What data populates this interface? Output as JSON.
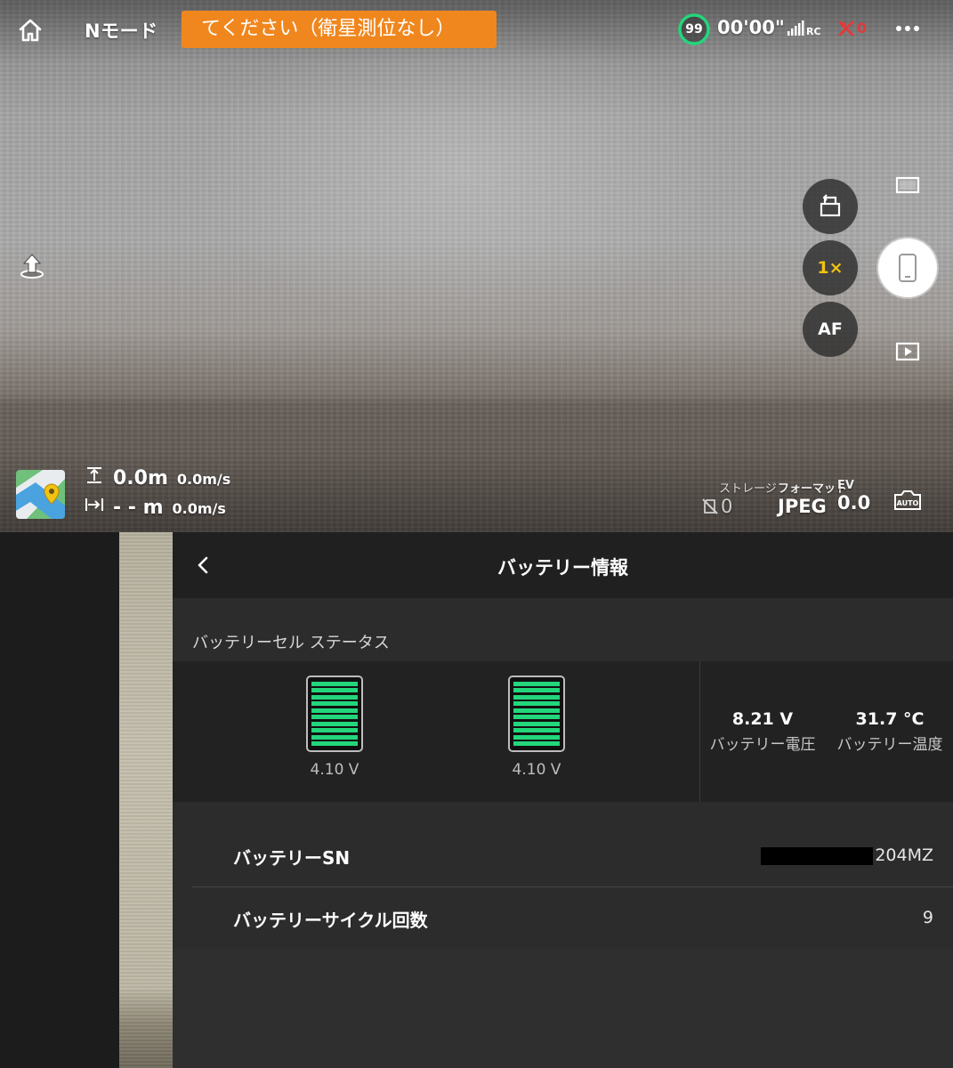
{
  "top_bar": {
    "mode": "Nモード",
    "warning": "てください（衛星測位なし）",
    "battery_percent": "99",
    "flight_time": "00'00\"",
    "gps_count": "0",
    "colors": {
      "warning_bg": "#f0871e",
      "battery_green": "#23d67b",
      "gps_red": "#e03b3b"
    }
  },
  "camera_controls": {
    "zoom": "1×",
    "af": "AF"
  },
  "telemetry": {
    "height": "0.0m",
    "vertical_speed": "0.0m/s",
    "distance": "- - m",
    "horizontal_speed": "0.0m/s"
  },
  "camera_params": {
    "storage_label": "ストレージ",
    "storage_value": "0",
    "format_label": "フォーマット",
    "format_value": "JPEG",
    "ev_label": "EV",
    "ev_value": "0.0"
  },
  "battery_panel": {
    "title": "バッテリー情報",
    "section_label": "バッテリーセル ステータス",
    "cells": [
      {
        "voltage": "4.10 V"
      },
      {
        "voltage": "4.10 V"
      }
    ],
    "voltage_value": "8.21 V",
    "voltage_label": "バッテリー電圧",
    "temperature_value": "31.7 °C",
    "temperature_label": "バッテリー温度",
    "serial_label": "バッテリーSN",
    "serial_value": "204MZ",
    "cycle_label": "バッテリーサイクル回数",
    "cycle_value": "9"
  }
}
